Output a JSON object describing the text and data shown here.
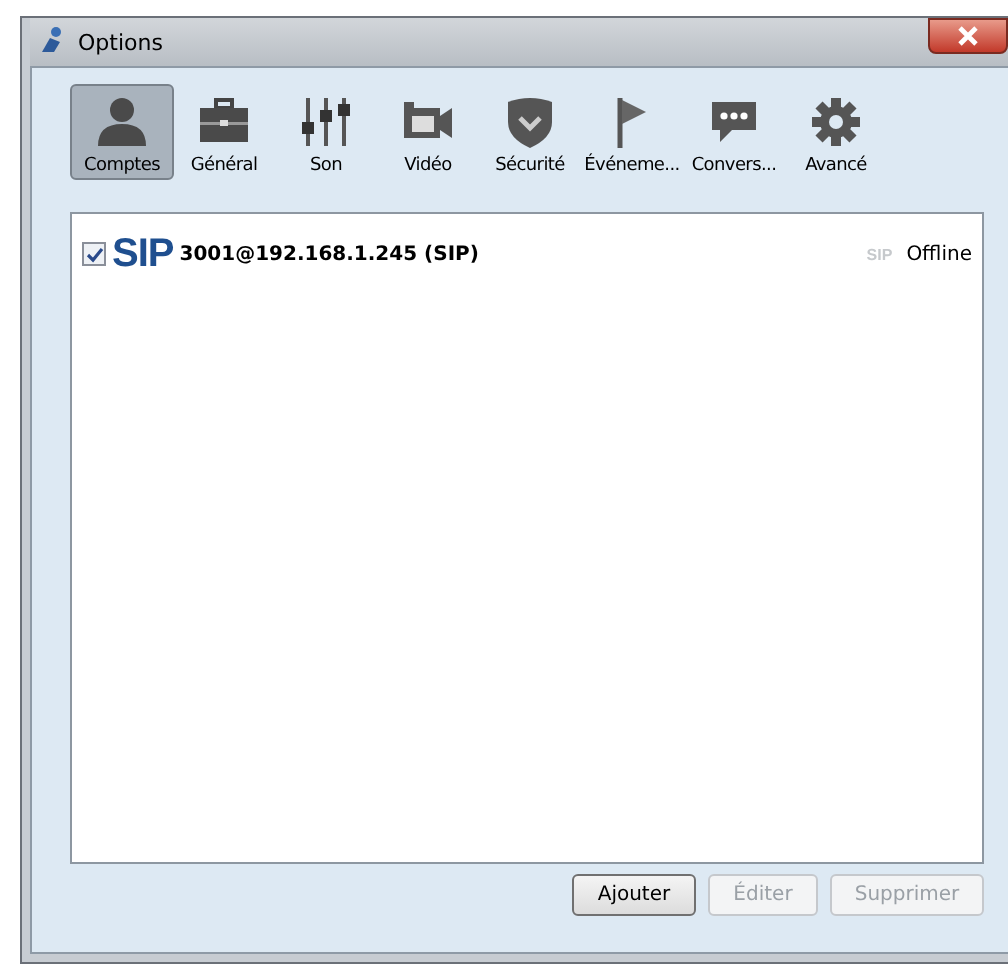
{
  "window": {
    "title": "Options"
  },
  "tabs": [
    {
      "label": "Comptes",
      "kind": "person",
      "selected": true
    },
    {
      "label": "Général",
      "kind": "briefcase",
      "selected": false
    },
    {
      "label": "Son",
      "kind": "sliders",
      "selected": false
    },
    {
      "label": "Vidéo",
      "kind": "camera",
      "selected": false
    },
    {
      "label": "Sécurité",
      "kind": "shield",
      "selected": false
    },
    {
      "label": "Événeme...",
      "kind": "flag",
      "selected": false
    },
    {
      "label": "Convers...",
      "kind": "chat",
      "selected": false
    },
    {
      "label": "Avancé",
      "kind": "gear",
      "selected": false
    }
  ],
  "accounts": [
    {
      "checked": true,
      "logo": "SIP",
      "name": "3001@192.168.1.245 (SIP)",
      "protocol": "SIP",
      "status": "Offline"
    }
  ],
  "buttons": [
    {
      "label": "Ajouter",
      "disabled": false
    },
    {
      "label": "Éditer",
      "disabled": true
    },
    {
      "label": "Supprimer",
      "disabled": true
    }
  ]
}
